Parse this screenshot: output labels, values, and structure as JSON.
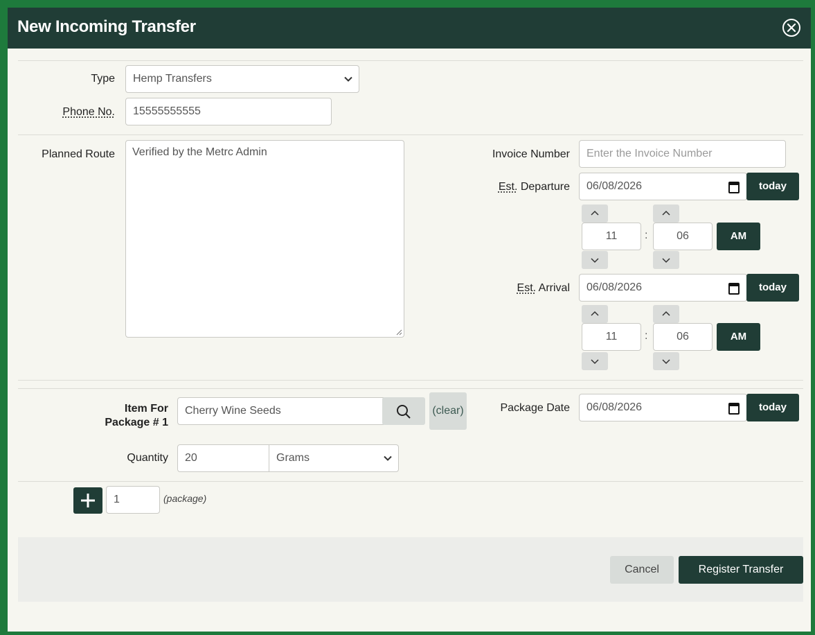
{
  "dialog": {
    "title": "New Incoming Transfer",
    "close_icon": "close-circle-x-icon"
  },
  "transfer": {
    "type_label": "Type",
    "type_value": "Hemp Transfers",
    "phone_label": "Phone No.",
    "phone_value": "15555555555",
    "route_label": "Planned Route",
    "route_value": "Verified by the Metrc Admin",
    "invoice_label": "Invoice Number",
    "invoice_placeholder": "Enter the Invoice Number",
    "departure_label_abbr": "Est.",
    "departure_label_rest": " Departure",
    "departure_date": "06/08/2026",
    "departure_hour": "11",
    "departure_minute": "06",
    "departure_ampm": "AM",
    "arrival_label_abbr": "Est.",
    "arrival_label_rest": " Arrival",
    "arrival_date": "06/08/2026",
    "arrival_hour": "11",
    "arrival_minute": "06",
    "arrival_ampm": "AM",
    "today_label": "today",
    "time_separator": ":"
  },
  "package": {
    "item_label_line1": "Item For",
    "item_label_line2": "Package # 1",
    "item_value": "Cherry Wine Seeds",
    "search_icon": "search-icon",
    "clear_label": "(clear)",
    "package_date_label": "Package Date",
    "package_date": "06/08/2026",
    "quantity_label": "Quantity",
    "quantity_value": "20",
    "unit_value": "Grams"
  },
  "add_packages": {
    "count_value": "1",
    "hint": "(package)"
  },
  "footer": {
    "cancel_label": "Cancel",
    "submit_label": "Register Transfer"
  },
  "colors": {
    "header_bg": "#203d36",
    "frame_green": "#1e7a3c",
    "button_dark": "#203d36",
    "button_grey": "#d8dcd9"
  }
}
